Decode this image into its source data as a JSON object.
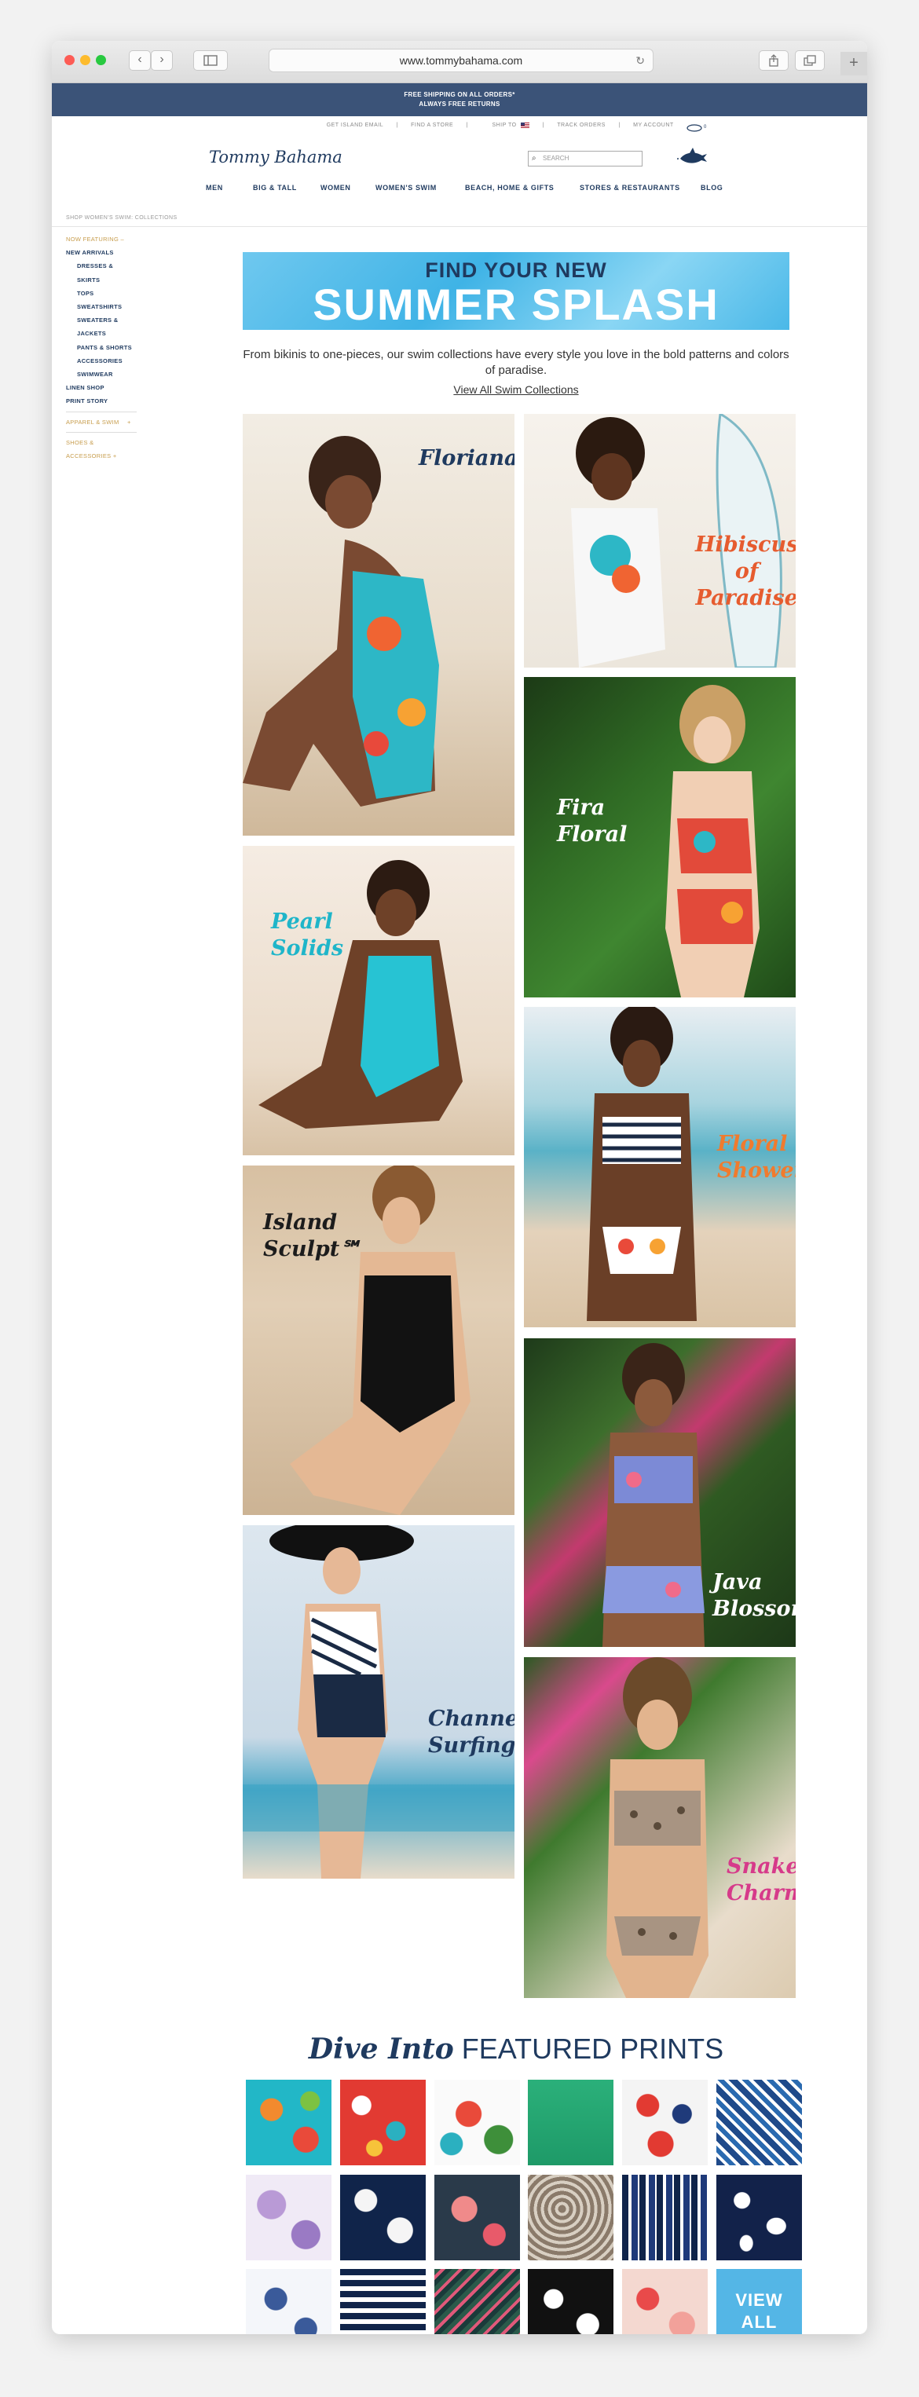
{
  "browser": {
    "url": "www.tommybahama.com",
    "back": "‹",
    "forward": "›",
    "reload": "↻"
  },
  "shipping": {
    "line1": "FREE SHIPPING ON ALL ORDERS*",
    "line2": "ALWAYS FREE RETURNS"
  },
  "utility": {
    "items": [
      "GET ISLAND EMAIL",
      "FIND A STORE",
      "SHIP TO",
      "TRACK ORDERS",
      "MY ACCOUNT"
    ],
    "separator": "|",
    "flag_icon": "us-flag-icon",
    "bag_count": "0"
  },
  "header": {
    "logo": "Tommy Bahama",
    "search_placeholder": "SEARCH",
    "search_icon": "search-icon",
    "marlin_icon": "marlin-icon"
  },
  "nav": [
    "MEN",
    "BIG & TALL",
    "WOMEN",
    "WOMEN'S SWIM",
    "BEACH, HOME & GIFTS",
    "STORES & RESTAURANTS",
    "BLOG"
  ],
  "breadcrumb": "SHOP WOMEN'S SWIM: COLLECTIONS",
  "sidebar": {
    "now_featuring": "NOW FEATURING",
    "new_arrivals": "NEW ARRIVALS",
    "sub": [
      "DRESSES & SKIRTS",
      "TOPS",
      "SWEATSHIRTS",
      "SWEATERS & JACKETS",
      "PANTS & SHORTS",
      "ACCESSORIES",
      "SWIMWEAR"
    ],
    "linen_shop": "LINEN SHOP",
    "print_story": "PRINT STORY",
    "apparel": "APPAREL & SWIM",
    "shoes": "SHOES & ACCESSORIES",
    "plus": "+"
  },
  "hero": {
    "line1": "FIND YOUR NEW",
    "line2": "SUMMER SPLASH"
  },
  "intro": {
    "text": "From bikinis to one-pieces, our swim collections have every style you love in the bold patterns and colors of paradise.",
    "link": "View All Swim Collections"
  },
  "collections": {
    "floriana": "Floriana",
    "hibiscus": "Hibiscus\nof\nParadise",
    "fira": "Fira\nFloral",
    "pearl": "Pearl\nSolids",
    "floral_showers": "Floral\nShowers",
    "island_sculpt": "Island\nSculpt℠",
    "java": "Java\nBlossom",
    "channel": "Channel\nSurfing",
    "snake": "Snake\nCharmer"
  },
  "prints": {
    "title_script": "Dive Into",
    "title_caps": "FEATURED PRINTS",
    "view_all": "VIEW\nALL"
  },
  "colors": {
    "navy": "#1f3a5f",
    "gold": "#c79d4d",
    "ship_bar": "#3b5378",
    "sky": "#54b6e6"
  }
}
